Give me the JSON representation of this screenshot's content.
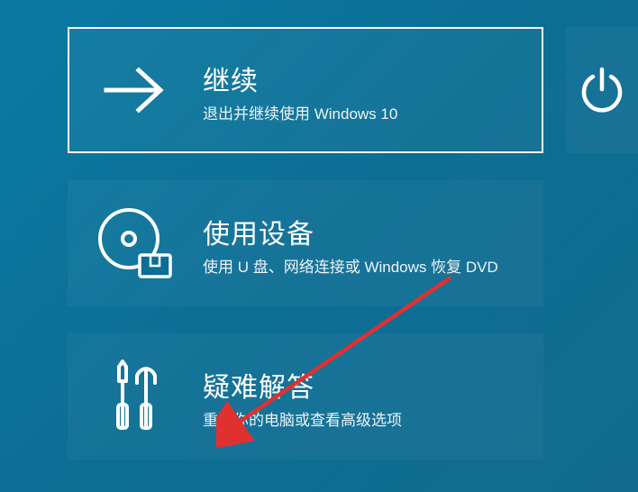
{
  "options": {
    "continue": {
      "title": "继续",
      "desc": "退出并继续使用 Windows 10"
    },
    "useDevice": {
      "title": "使用设备",
      "desc": "使用 U 盘、网络连接或 Windows 恢复 DVD"
    },
    "troubleshoot": {
      "title": "疑难解答",
      "desc": "重置你的电脑或查看高级选项"
    }
  }
}
